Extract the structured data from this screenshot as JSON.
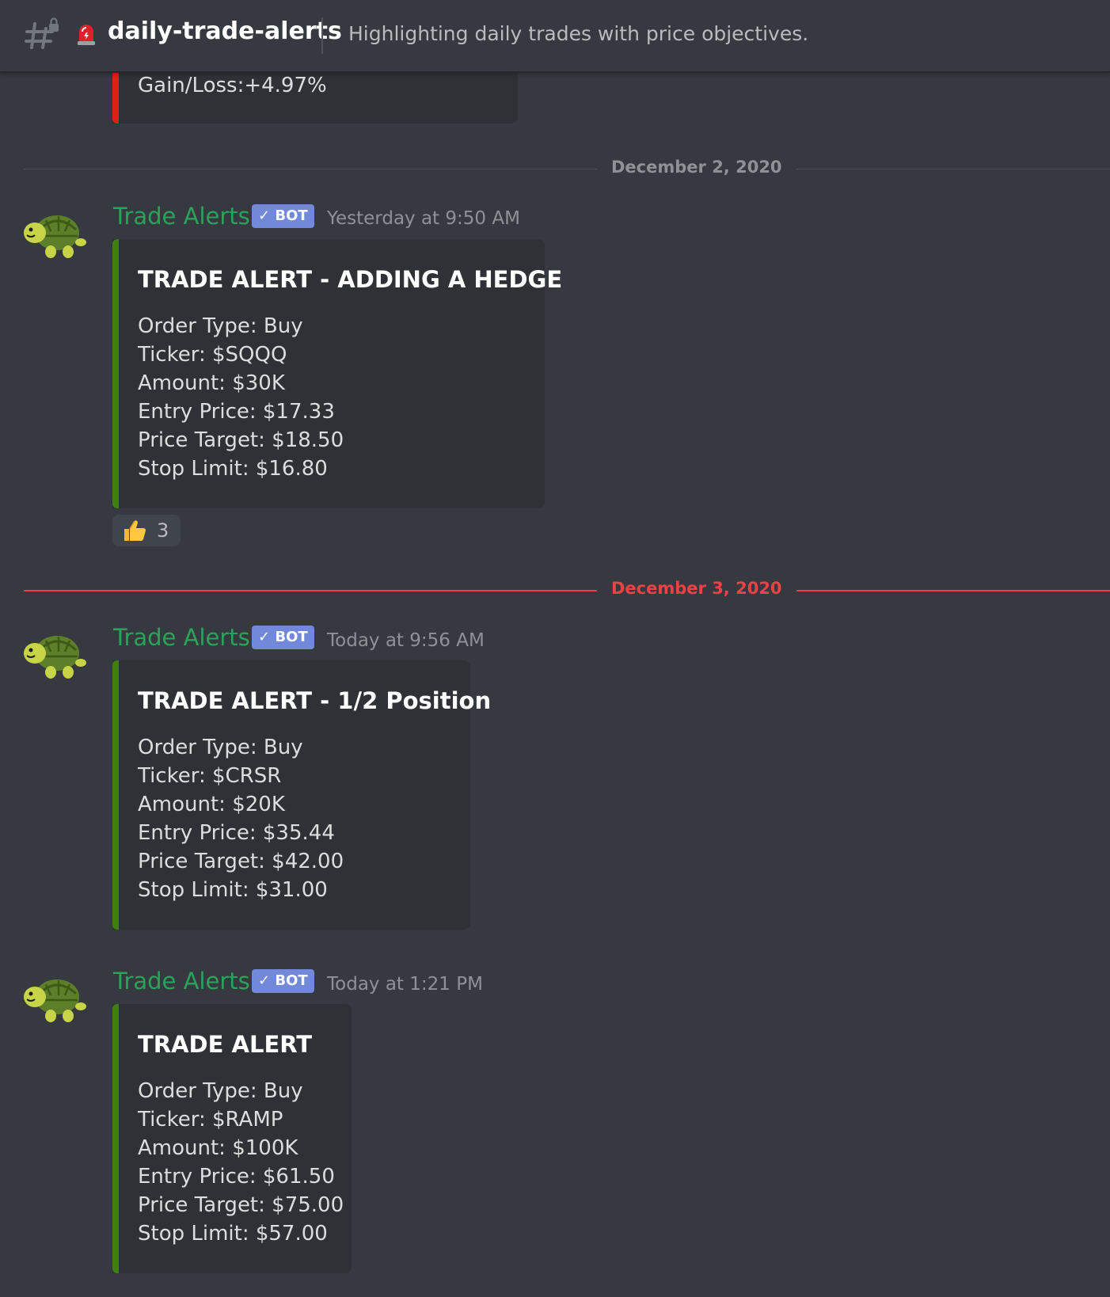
{
  "header": {
    "channel_name": "daily-trade-alerts",
    "topic": "Highlighting daily trades with price objectives.",
    "icons": [
      "hash-lock-icon",
      "siren-icon"
    ]
  },
  "previous_embed": {
    "lines": [
      "Gain/Loss:+4.97%"
    ],
    "accent": "#e01e1e"
  },
  "dividers": [
    {
      "label": "December 2, 2020",
      "color": "#8e9297"
    },
    {
      "label": "December 3, 2020",
      "color": "#ed4245"
    }
  ],
  "messages": [
    {
      "author": "Trade Alerts",
      "badge": "✓ BOT",
      "timestamp": "Yesterday at 9:50 AM",
      "avatar_icon": "turtle-icon",
      "embed": {
        "title": "TRADE ALERT - ADDING A HEDGE",
        "accent": "#3f7f14",
        "lines": [
          "Order Type: Buy",
          "Ticker: $SQQQ",
          "Amount: $30K",
          "Entry Price: $17.33",
          "Price Target: $18.50",
          "Stop Limit: $16.80"
        ]
      },
      "reaction": {
        "icon": "thumbs-up-icon",
        "count": "3"
      }
    },
    {
      "author": "Trade Alerts",
      "badge": "✓ BOT",
      "timestamp": "Today at 9:56 AM",
      "avatar_icon": "turtle-icon",
      "embed": {
        "title": "TRADE ALERT - 1/2 Position",
        "accent": "#3f7f14",
        "lines": [
          "Order Type: Buy",
          "Ticker: $CRSR",
          "Amount: $20K",
          "Entry Price: $35.44",
          "Price Target: $42.00",
          "Stop Limit: $31.00"
        ]
      }
    },
    {
      "author": "Trade Alerts",
      "badge": "✓ BOT",
      "timestamp": "Today at 1:21 PM",
      "avatar_icon": "turtle-icon",
      "embed": {
        "title": "TRADE ALERT",
        "accent": "#3f7f14",
        "lines": [
          "Order Type: Buy",
          "Ticker: $RAMP",
          "Amount: $100K",
          "Entry Price: $61.50",
          "Price Target: $75.00",
          "Stop Limit: $57.00"
        ]
      }
    }
  ],
  "colors": {
    "background": "#36393f",
    "embed_bg": "#2f3136",
    "author": "#2aa35a",
    "bot_badge": "#7289da",
    "new_divider": "#ed4245"
  }
}
